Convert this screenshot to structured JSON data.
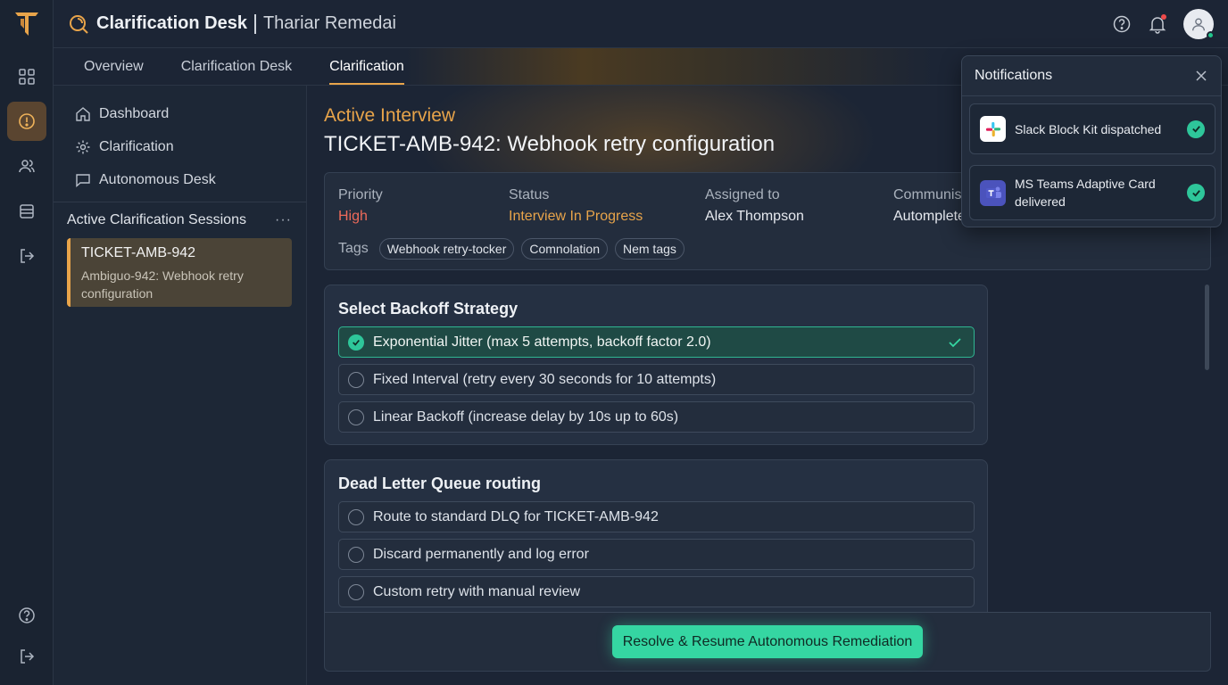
{
  "header": {
    "app_title": "Clarification Desk",
    "org_name": "Thariar Remedai"
  },
  "tabs": [
    {
      "label": "Overview"
    },
    {
      "label": "Clarification Desk"
    },
    {
      "label": "Clarification",
      "active": true
    }
  ],
  "sidebar": {
    "nav": [
      {
        "label": "Dashboard",
        "icon": "home-icon"
      },
      {
        "label": "Clarification",
        "icon": "gear-icon"
      },
      {
        "label": "Autonomous Desk",
        "icon": "chat-icon"
      }
    ],
    "sessions_title": "Active Clarification Sessions",
    "sessions_more": "···",
    "sessions": [
      {
        "id": "TICKET-AMB-942",
        "desc": "Ambiguo-942: Webhook retry configuration"
      }
    ]
  },
  "main": {
    "kicker": "Active Interview",
    "title": "TICKET-AMB-942: Webhook retry configuration",
    "info": {
      "priority_label": "Priority",
      "priority_value": "High",
      "status_label": "Status",
      "status_value": "Interview In Progress",
      "assigned_label": "Assigned to",
      "assigned_value": "Alex Thompson",
      "comm_label": "Communist",
      "comm_value": "Automplete"
    },
    "tags_label": "Tags",
    "tags": [
      "Webhook retry-tocker",
      "Comnolation",
      "Nem tags"
    ],
    "backoff": {
      "title": "Select Backoff Strategy",
      "options": [
        "Exponential Jitter (max 5 attempts, backoff factor 2.0)",
        "Fixed Interval (retry every 30 seconds for 10 attempts)",
        "Linear Backoff (increase delay by 10s up to 60s)"
      ],
      "selected_index": 0
    },
    "dlq": {
      "title": "Dead Letter Queue routing",
      "options": [
        "Route to standard DLQ for TICKET-AMB-942",
        "Discard permanently and log error",
        "Custom retry with manual review"
      ]
    },
    "resolve_label": "Resolve & Resume Autonomous Remediation"
  },
  "notifications": {
    "title": "Notifications",
    "items": [
      {
        "app": "slack-icon",
        "text": "Slack Block Kit dispatched"
      },
      {
        "app": "teams-icon",
        "text": "MS Teams Adaptive Card delivered"
      }
    ]
  },
  "colors": {
    "accent": "#e8a44a",
    "success": "#2ec69a",
    "priority_high": "#ef6a5a",
    "background": "#1c2535"
  }
}
